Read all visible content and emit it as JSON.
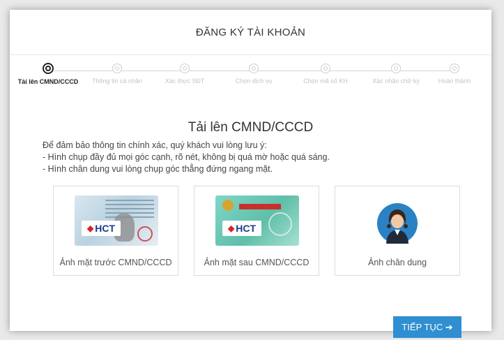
{
  "title": "ĐĂNG KÝ TÀI KHOẢN",
  "steps": [
    {
      "label": "Tải lên CMND/CCCD",
      "active": true
    },
    {
      "label": "Thông tin cá nhân",
      "active": false
    },
    {
      "label": "Xác thực SĐT",
      "active": false
    },
    {
      "label": "Chọn dịch vụ",
      "active": false
    },
    {
      "label": "Chọn mã số KH",
      "active": false
    },
    {
      "label": "Xác nhận chữ ký",
      "active": false
    },
    {
      "label": "Hoàn thành",
      "active": false
    }
  ],
  "upload": {
    "heading": "Tải lên CMND/CCCD",
    "notes": [
      "Để đảm bảo thông tin chính xác, quý khách vui lòng lưu ý:",
      "- Hình chụp đầy đủ mọi góc cạnh, rõ nét, không bị quá mờ hoặc quá sáng.",
      "- Hình chân dung vui lòng chụp góc thẳng đứng ngang mặt."
    ],
    "cards": [
      {
        "caption": "Ảnh mặt trước CMND/CCCD",
        "logo": "HCT"
      },
      {
        "caption": "Ảnh mặt sau CMND/CCCD",
        "logo": "HCT"
      },
      {
        "caption": "Ảnh chân dung"
      }
    ]
  },
  "continue_label": "TIẾP TỤC ➔",
  "colors": {
    "accent": "#2f8fd0",
    "active_step": "#222222",
    "inactive_step": "#c4c4c4"
  }
}
